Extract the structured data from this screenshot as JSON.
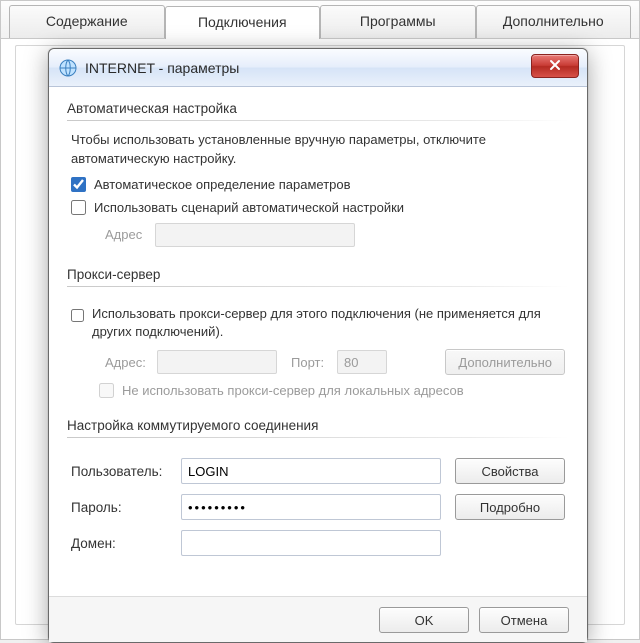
{
  "tabs": [
    "Содержание",
    "Подключения",
    "Программы",
    "Дополнительно"
  ],
  "activeTab": 1,
  "dialog": {
    "title": "INTERNET - параметры",
    "auto": {
      "title": "Автоматическая настройка",
      "desc": "Чтобы использовать установленные вручную параметры, отключите автоматическую настройку.",
      "cbAutoDetect": "Автоматическое определение параметров",
      "cbScript": "Использовать сценарий автоматической настройки",
      "addrLabel": "Адрес",
      "addrValue": ""
    },
    "proxy": {
      "title": "Прокси-сервер",
      "cbUse": "Использовать прокси-сервер для этого подключения (не применяется для других подключений).",
      "addrLabel": "Адрес:",
      "addrValue": "",
      "portLabel": "Порт:",
      "portValue": "80",
      "advBtn": "Дополнительно",
      "cbBypass": "Не использовать прокси-сервер для локальных адресов"
    },
    "dial": {
      "title": "Настройка коммутируемого соединения",
      "userLabel": "Пользователь:",
      "userValue": "LOGIN",
      "passLabel": "Пароль:",
      "passValue": "•••••••••",
      "domainLabel": "Домен:",
      "domainValue": "",
      "propsBtn": "Свойства",
      "detailsBtn": "Подробно"
    },
    "ok": "OK",
    "cancel": "Отмена"
  }
}
